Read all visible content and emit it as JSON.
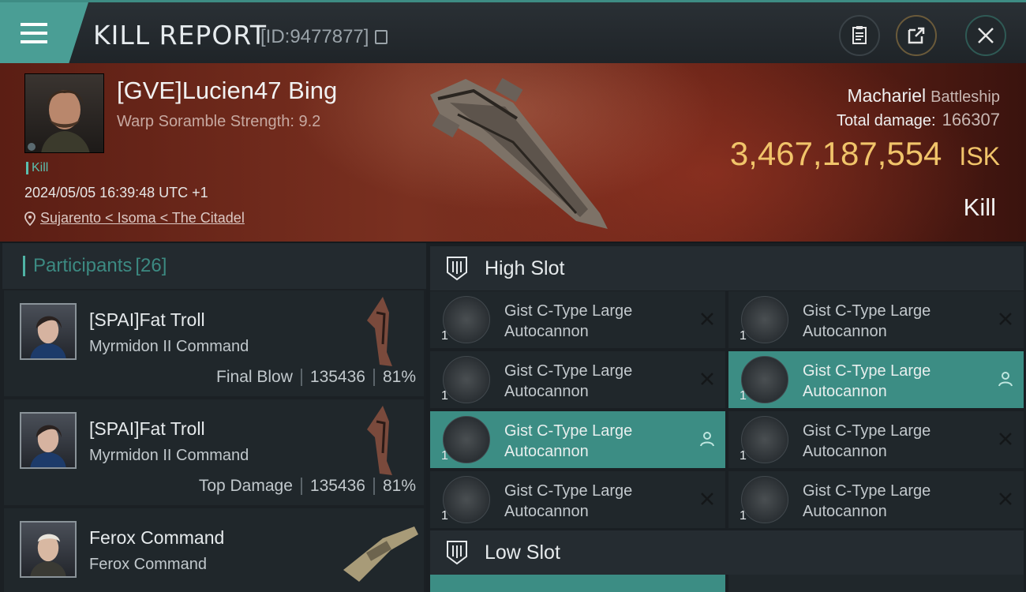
{
  "header": {
    "title": "KILL REPORT",
    "report_id": "[ID:9477877]",
    "icons": [
      "menu-icon",
      "copy-icon",
      "clipboard-icon",
      "share-icon",
      "close-icon"
    ]
  },
  "victim": {
    "pilot_name": "[GVE]Lucien47 Bing",
    "warp_scramble": "Warp Soramble Strength: 9.2",
    "kill_tag": "Kill",
    "datetime": "2024/05/05 16:39:48 UTC +1",
    "location": "Sujarento < Isoma < The Citadel",
    "ship_name": "Machariel",
    "ship_class": "Battleship",
    "total_damage_label": "Total damage:",
    "total_damage": "166307",
    "isk_value": "3,467,187,554",
    "isk_unit": "ISK",
    "result": "Kill"
  },
  "participants": {
    "label": "Participants",
    "count": "[26]",
    "items": [
      {
        "name": "[SPAI]Fat Troll",
        "ship": "Myrmidon II Command",
        "role": "Final Blow",
        "damage": "135436",
        "percent": "81%"
      },
      {
        "name": "[SPAI]Fat Troll",
        "ship": "Myrmidon II Command",
        "role": "Top Damage",
        "damage": "135436",
        "percent": "81%"
      },
      {
        "name": "Ferox Command",
        "ship": "Ferox Command"
      }
    ]
  },
  "slots": {
    "high_label": "High Slot",
    "low_label": "Low Slot",
    "modules": [
      {
        "name": "Gist C-Type Large Autocannon",
        "qty": "1",
        "state": "destroyed"
      },
      {
        "name": "Gist C-Type Large Autocannon",
        "qty": "1",
        "state": "destroyed"
      },
      {
        "name": "Gist C-Type Large Autocannon",
        "qty": "1",
        "state": "destroyed"
      },
      {
        "name": "Gist C-Type Large Autocannon",
        "qty": "1",
        "state": "dropped"
      },
      {
        "name": "Gist C-Type Large Autocannon",
        "qty": "1",
        "state": "dropped"
      },
      {
        "name": "Gist C-Type Large Autocannon",
        "qty": "1",
        "state": "destroyed"
      },
      {
        "name": "Gist C-Type Large Autocannon",
        "qty": "1",
        "state": "destroyed"
      },
      {
        "name": "Gist C-Type Large Autocannon",
        "qty": "1",
        "state": "destroyed"
      }
    ]
  },
  "colors": {
    "accent": "#3c8d84",
    "isk": "#f1c46a",
    "banner": "#6a2418"
  }
}
